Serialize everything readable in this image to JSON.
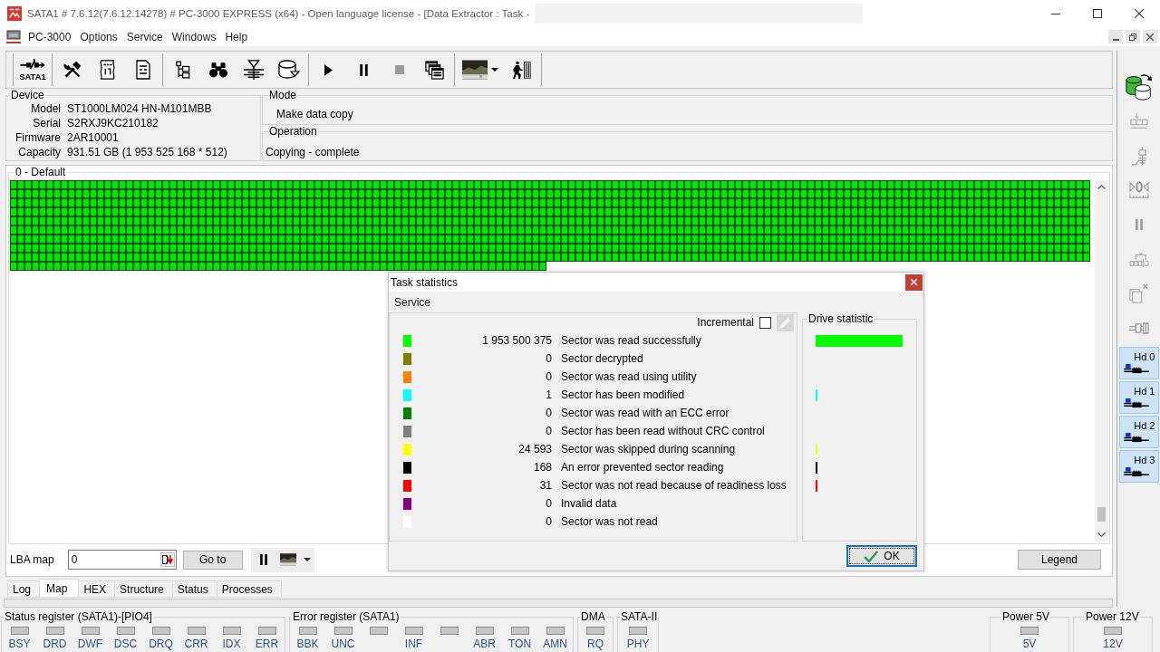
{
  "window": {
    "title": "SATA1 # 7.6.12(7.6.12.14278) # PC-3000 EXPRESS (x64) - Open language license - [Data Extractor : Task -"
  },
  "menu": [
    "PC-3000",
    "Options",
    "Service",
    "Windows",
    "Help"
  ],
  "toolbar": [
    {
      "buttons": [
        {
          "kind": "port",
          "label": "SATA1",
          "disabled": false
        }
      ]
    },
    {
      "buttons": [
        {
          "kind": "tools",
          "disabled": false
        },
        {
          "kind": "binary",
          "disabled": false
        },
        {
          "kind": "percent",
          "disabled": false
        }
      ]
    },
    {
      "buttons": [
        {
          "kind": "tree",
          "disabled": false
        },
        {
          "kind": "binoculars",
          "disabled": false
        },
        {
          "kind": "funnel",
          "disabled": false
        },
        {
          "kind": "disk",
          "disabled": false
        }
      ]
    },
    {
      "buttons": [
        {
          "kind": "play",
          "disabled": false
        },
        {
          "kind": "pause",
          "disabled": false
        },
        {
          "kind": "stop",
          "disabled": true
        },
        {
          "kind": "windows",
          "disabled": false
        }
      ]
    },
    {
      "buttons": [
        {
          "kind": "image",
          "disabled": false
        },
        {
          "kind": "walker",
          "disabled": false
        }
      ]
    }
  ],
  "device": {
    "title": "Device",
    "fields": [
      {
        "label": "Model",
        "value": "ST1000LM024 HN-M101MBB"
      },
      {
        "label": "Serial",
        "value": "S2RXJ9KC210182"
      },
      {
        "label": "Firmware",
        "value": "2AR10001"
      },
      {
        "label": "Capacity",
        "value": "931.51 GB (1 953 525 168 * 512)"
      }
    ]
  },
  "mode": {
    "title": "Mode",
    "value": "Make data copy"
  },
  "operation": {
    "title": "Operation",
    "value": "Copying - complete"
  },
  "map": {
    "title": "0 - Default"
  },
  "lba_map": {
    "label": "LBA map",
    "value": "0",
    "go_button": "Go to",
    "legend_button": "Legend"
  },
  "tabs": [
    {
      "label": "Log",
      "selected": false
    },
    {
      "label": "Map",
      "selected": true
    },
    {
      "label": "HEX",
      "selected": false
    },
    {
      "label": "Structure",
      "selected": false
    },
    {
      "label": "Status",
      "selected": false
    },
    {
      "label": "Processes",
      "selected": false
    }
  ],
  "side_toolbar": [
    {
      "kind": "database",
      "disabled": false
    },
    {
      "kind": "reset",
      "disabled": true
    },
    {
      "kind": "switch",
      "disabled": true
    },
    {
      "kind": "gauge",
      "disabled": true
    },
    {
      "kind": "pause",
      "disabled": true
    },
    {
      "kind": "counter",
      "disabled": true
    },
    {
      "kind": "copy",
      "disabled": true
    },
    {
      "kind": "connector",
      "disabled": true
    }
  ],
  "drives": [
    {
      "label": "Hd 0"
    },
    {
      "label": "Hd 1"
    },
    {
      "label": "Hd 2"
    },
    {
      "label": "Hd 3"
    }
  ],
  "registers": [
    {
      "title": "Status register (SATA1)-[PIO4]",
      "leds": [
        {
          "label": "BSY",
          "on": false
        },
        {
          "label": "DRD",
          "on": false
        },
        {
          "label": "DWF",
          "on": false
        },
        {
          "label": "DSC",
          "on": false
        },
        {
          "label": "DRQ",
          "on": false
        },
        {
          "label": "CRR",
          "on": false
        },
        {
          "label": "IDX",
          "on": false
        },
        {
          "label": "ERR",
          "on": false
        }
      ]
    },
    {
      "title": "Error register (SATA1)",
      "leds": [
        {
          "label": "BBK",
          "on": false
        },
        {
          "label": "UNC",
          "on": false
        },
        {
          "on": false
        },
        {
          "label": "INF",
          "on": false
        },
        {
          "on": false
        },
        {
          "label": "ABR",
          "on": false
        },
        {
          "label": "TON",
          "on": false
        },
        {
          "label": "AMN",
          "on": false
        }
      ]
    },
    {
      "title": "DMA",
      "leds": [
        {
          "label": "RQ",
          "on": false
        }
      ]
    },
    {
      "title": "SATA-II",
      "leds": [
        {
          "label": "PHY",
          "on": false
        }
      ]
    }
  ],
  "power": [
    {
      "title": "Power 5V",
      "leds": [
        {
          "label": "5V",
          "on": false
        }
      ]
    },
    {
      "title": "Power 12V",
      "leds": [
        {
          "label": "12V",
          "on": false
        }
      ]
    }
  ],
  "dialog": {
    "title": "Task statistics",
    "menu": "Service",
    "incremental": {
      "label": "Incremental",
      "checked": false
    },
    "tool_button": {
      "disabled": true
    },
    "drive_statistic": "Drive statistic",
    "rows": [
      {
        "color": "#00ff00",
        "count": "1 953 500 375",
        "label": "Sector was read successfully"
      },
      {
        "color": "#808000",
        "count": "0",
        "label": "Sector decrypted"
      },
      {
        "color": "#ff8000",
        "count": "0",
        "label": "Sector was read using utility"
      },
      {
        "color": "#00ffff",
        "count": "1",
        "label": "Sector has been modified"
      },
      {
        "color": "#008000",
        "count": "0",
        "label": "Sector was read with an ECC error"
      },
      {
        "color": "#808080",
        "count": "0",
        "label": "Sector has been read without CRC control"
      },
      {
        "color": "#ffff00",
        "count": "24 593",
        "label": "Sector was skipped during scanning"
      },
      {
        "color": "#000000",
        "count": "168",
        "label": "An error prevented sector reading"
      },
      {
        "color": "#ff0000",
        "count": "31",
        "label": "Sector was not read because of readiness loss"
      },
      {
        "color": "#800080",
        "count": "0",
        "label": "Invalid data"
      },
      {
        "color": "#ffffff",
        "count": "0",
        "label": "Sector was not read"
      }
    ],
    "ok_button": "OK"
  }
}
